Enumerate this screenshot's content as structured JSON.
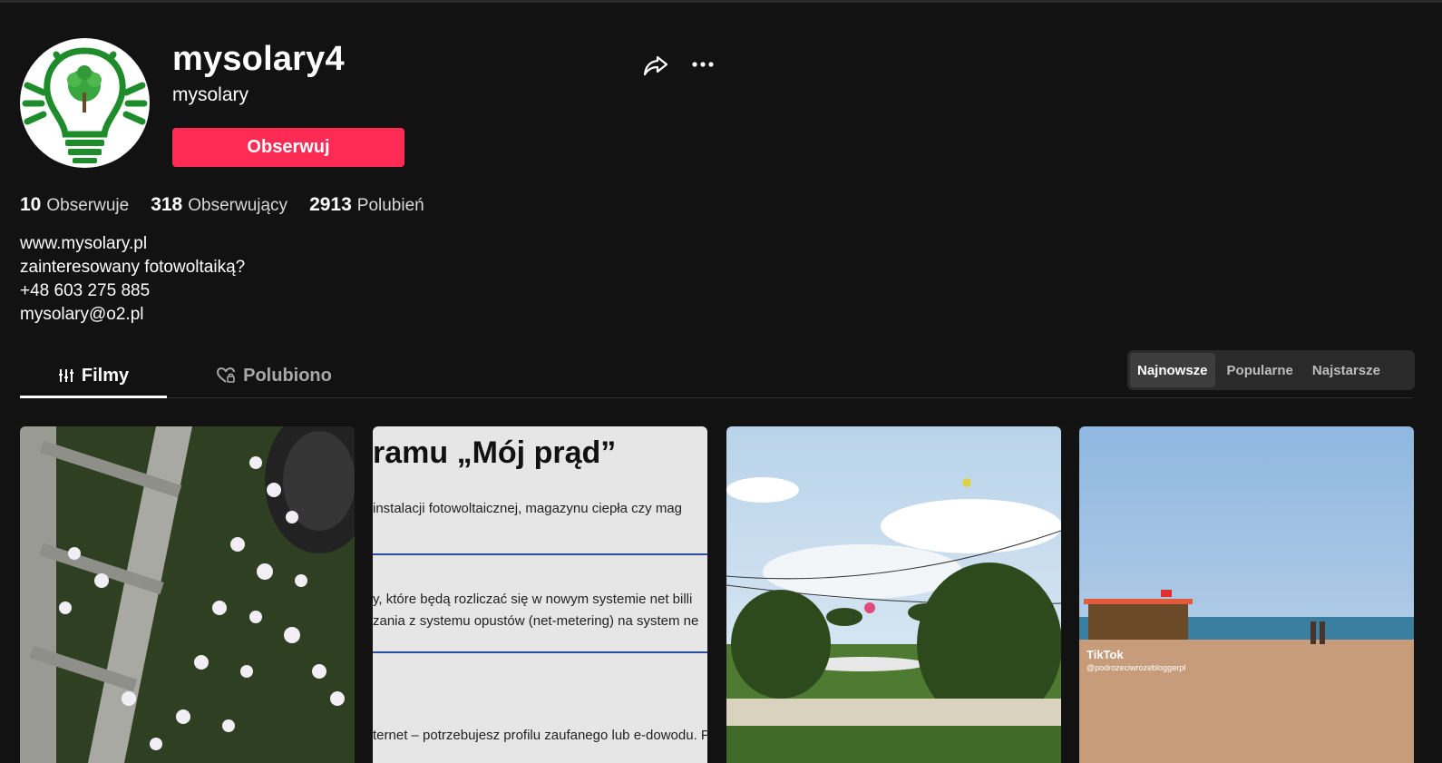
{
  "profile": {
    "username": "mysolary4",
    "nickname": "mysolary",
    "follow_label": "Obserwuj"
  },
  "stats": [
    {
      "value": "10",
      "label": "Obserwuje"
    },
    {
      "value": "318",
      "label": "Obserwujący"
    },
    {
      "value": "2913",
      "label": "Polubień"
    }
  ],
  "bio": [
    "www.mysolary.pl",
    "zainteresowany fotowoltaiką?",
    "+48 603 275 885",
    "mysolary@o2.pl"
  ],
  "tabs": {
    "videos": "Filmy",
    "liked": "Polubiono"
  },
  "sort": {
    "newest": "Najnowsze",
    "popular": "Popularne",
    "oldest": "Najstarsze"
  },
  "videos": {
    "v2_title": "ramu „Mój prąd”",
    "v2_line1": "instalacji fotowoltaicznej, magazynu ciepła czy mag",
    "v2_line2": "y, które będą rozliczać się w nowym systemie net billi",
    "v2_line3": "zania z systemu opustów (net-metering) na system ne",
    "v2_line4": "ternet – potrzebujesz profilu zaufanego lub e-dowodu. P",
    "v4_watermark": "TikTok",
    "v4_handle": "@podrozeciwrozebloggerpl"
  },
  "colors": {
    "background": "#121212",
    "accent": "#fe2c55",
    "logo_green": "#1e8c2a"
  }
}
